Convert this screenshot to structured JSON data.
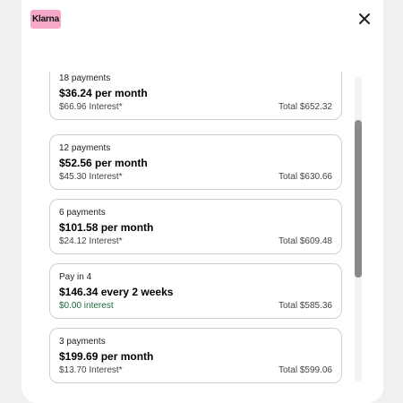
{
  "header": {
    "logo_text": "Klarna",
    "close_icon": "close-icon"
  },
  "plans": [
    {
      "count": "18 payments",
      "price": "$36.24 per month",
      "interest": "$66.96 Interest*",
      "total": "Total $652.32"
    },
    {
      "count": "12 payments",
      "price": "$52.56 per month",
      "interest": "$45.30 Interest*",
      "total": "Total $630.66"
    },
    {
      "count": "6 payments",
      "price": "$101.58 per month",
      "interest": "$24.12 Interest*",
      "total": "Total $609.48"
    },
    {
      "count": "Pay in 4",
      "price": "$146.34 every 2 weeks",
      "interest": "$0.00 interest",
      "total": "Total $585.36"
    },
    {
      "count": "3 payments",
      "price": "$199.69 per month",
      "interest": "$13.70 Interest*",
      "total": "Total $599.06"
    }
  ],
  "colors": {
    "logo_pink": "#f6a8c9",
    "zero_interest_green": "#1b6b3a",
    "card_border": "#cfcfcf"
  }
}
